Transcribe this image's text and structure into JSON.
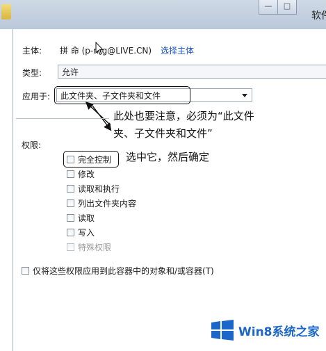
{
  "window": {
    "title": "软件",
    "minimize_label": "—",
    "maximize_label": "□"
  },
  "principal": {
    "label": "主体:",
    "value": "拼 命 (p-rng@LIVE.CN)",
    "select_link": "选择主体"
  },
  "type": {
    "label": "类型:",
    "value": "允许"
  },
  "applies_to": {
    "label": "应用于:",
    "value": "此文件夹、子文件夹和文件"
  },
  "annotations": {
    "note_line1": "此处也要注意，必须为“此文件",
    "note_line2": "夹、子文件夹和文件”",
    "select_note": "选中它，然后确定"
  },
  "permissions": {
    "label": "权限:",
    "items": [
      {
        "label": "完全控制",
        "checked": false,
        "disabled": false
      },
      {
        "label": "修改",
        "checked": false,
        "disabled": false
      },
      {
        "label": "读取和执行",
        "checked": false,
        "disabled": false
      },
      {
        "label": "列出文件夹内容",
        "checked": false,
        "disabled": false
      },
      {
        "label": "读取",
        "checked": false,
        "disabled": false
      },
      {
        "label": "写入",
        "checked": false,
        "disabled": false
      },
      {
        "label": "特殊权限",
        "checked": false,
        "disabled": true
      }
    ]
  },
  "apply_only": {
    "label": "仅将这些权限应用到此容器中的对象和/或容器(T)"
  },
  "watermark": {
    "text": "Win8系统之家"
  },
  "colors": {
    "link": "#1a55c8",
    "watermark": "#1a66c9"
  }
}
